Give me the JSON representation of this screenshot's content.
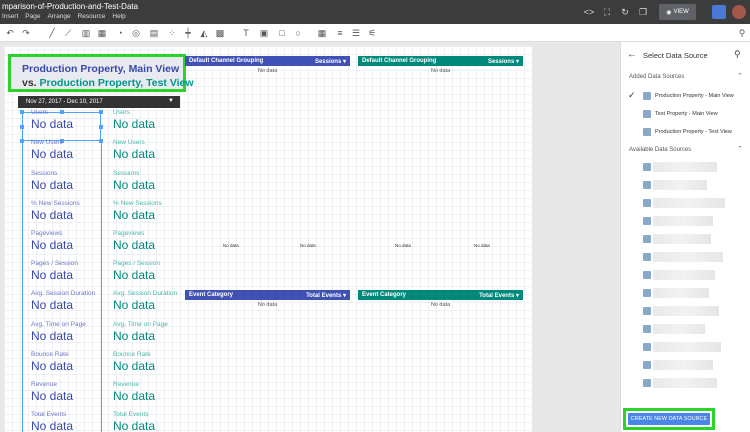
{
  "app": {
    "doc_title": "mparison-of-Production-and-Test-Data",
    "menu": [
      "Insert",
      "Page",
      "Arrange",
      "Resource",
      "Help"
    ],
    "view_label": "VIEW"
  },
  "report": {
    "title_main": "Production Property, Main View",
    "title_vs": "vs.",
    "title_test": "Production Property, Test View",
    "date_range": "Nov 27, 2017 - Dec 10, 2017",
    "metrics": [
      {
        "label": "Users",
        "value": "No data"
      },
      {
        "label": "New Users",
        "value": "No data"
      },
      {
        "label": "Sessions",
        "value": "No data"
      },
      {
        "label": "% New Sessions",
        "value": "No data"
      },
      {
        "label": "Pageviews",
        "value": "No data"
      },
      {
        "label": "Pages / Session",
        "value": "No data"
      },
      {
        "label": "Avg. Session Duration",
        "value": "No data"
      },
      {
        "label": "Avg. Time on Page",
        "value": "No data"
      },
      {
        "label": "Bounce Rate",
        "value": "No data"
      },
      {
        "label": "Revenue",
        "value": "No data"
      },
      {
        "label": "Total Events",
        "value": "No data"
      }
    ],
    "tables": [
      {
        "dimension": "Default Channel Grouping",
        "metric": "Sessions",
        "nodata": "No data"
      },
      {
        "dimension": "Default Channel Grouping",
        "metric": "Sessions",
        "nodata": "No data"
      },
      {
        "dimension": "Event Category",
        "metric": "Total Events",
        "nodata": "No data"
      },
      {
        "dimension": "Event Category",
        "metric": "Total Events",
        "nodata": "No data"
      }
    ],
    "chart_nodata": "No data",
    "colors": {
      "main": "#3f51b5",
      "test": "#00897b",
      "highlight": "#2bd32b"
    }
  },
  "panel": {
    "title": "Select Data Source",
    "added_heading": "Added Data Sources",
    "added_sources": [
      "Production Property - Main View",
      "Test Property - Main View",
      "Production Property - Test View"
    ],
    "available_heading": "Available Data Sources",
    "create_button": "CREATE NEW DATA SOURCE"
  }
}
